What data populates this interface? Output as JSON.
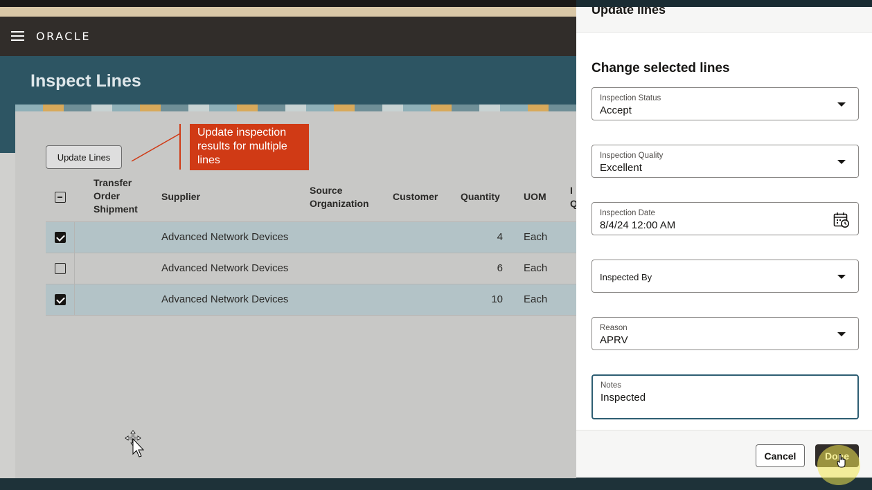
{
  "header": {
    "logo": "ORACLE"
  },
  "page": {
    "title": "Inspect Lines"
  },
  "toolbar": {
    "update_lines_label": "Update Lines"
  },
  "callout": {
    "text": "Update inspection results for multiple lines"
  },
  "table": {
    "columns": {
      "transfer_order_shipment": "Transfer Order Shipment",
      "supplier": "Supplier",
      "source_organization": "Source Organization",
      "customer": "Customer",
      "quantity": "Quantity",
      "uom": "UOM",
      "cut_col_line1": "I",
      "cut_col_line2": "Q"
    },
    "rows": [
      {
        "selected": true,
        "supplier": "Advanced Network Devices",
        "quantity": "4",
        "uom": "Each"
      },
      {
        "selected": false,
        "supplier": "Advanced Network Devices",
        "quantity": "6",
        "uom": "Each"
      },
      {
        "selected": true,
        "supplier": "Advanced Network Devices",
        "quantity": "10",
        "uom": "Each"
      }
    ]
  },
  "panel": {
    "header_title": "Update lines",
    "title": "Change selected lines",
    "fields": {
      "inspection_status": {
        "label": "Inspection Status",
        "value": "Accept"
      },
      "inspection_quality": {
        "label": "Inspection Quality",
        "value": "Excellent"
      },
      "inspection_date": {
        "label": "Inspection Date",
        "value": "8/4/24 12:00 AM"
      },
      "inspected_by": {
        "label": "Inspected By",
        "value": ""
      },
      "reason": {
        "label": "Reason",
        "value": "APRV"
      },
      "notes": {
        "label": "Notes",
        "value": "Inspected"
      }
    },
    "cancel_label": "Cancel",
    "done_label": "Done"
  },
  "colors": {
    "header": "#312d2a",
    "hero": "#2d5563",
    "callout": "#d03a15",
    "selected_row": "#b3c3c7",
    "primary_button": "#312d2a"
  }
}
